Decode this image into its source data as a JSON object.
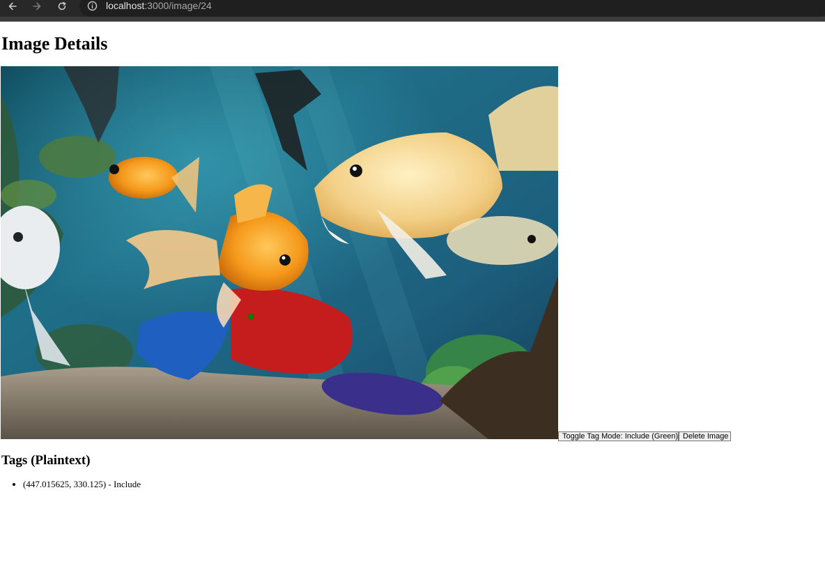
{
  "browser": {
    "url_host": "localhost",
    "url_path": ":3000/image/24",
    "icons": {
      "back": "back-arrow-icon",
      "forward": "forward-arrow-icon",
      "reload": "reload-icon",
      "site_info": "site-info-icon"
    }
  },
  "page": {
    "title": "Image Details",
    "image_alt": "goldfish-aquarium-photo",
    "tag_marker_color": "#008000"
  },
  "actions": {
    "toggle_label": "Toggle Tag Mode: Include (Green)",
    "delete_label": "Delete Image"
  },
  "tags": {
    "heading": "Tags (Plaintext)",
    "items": [
      {
        "text": "(447.015625, 330.125) - Include"
      }
    ]
  }
}
